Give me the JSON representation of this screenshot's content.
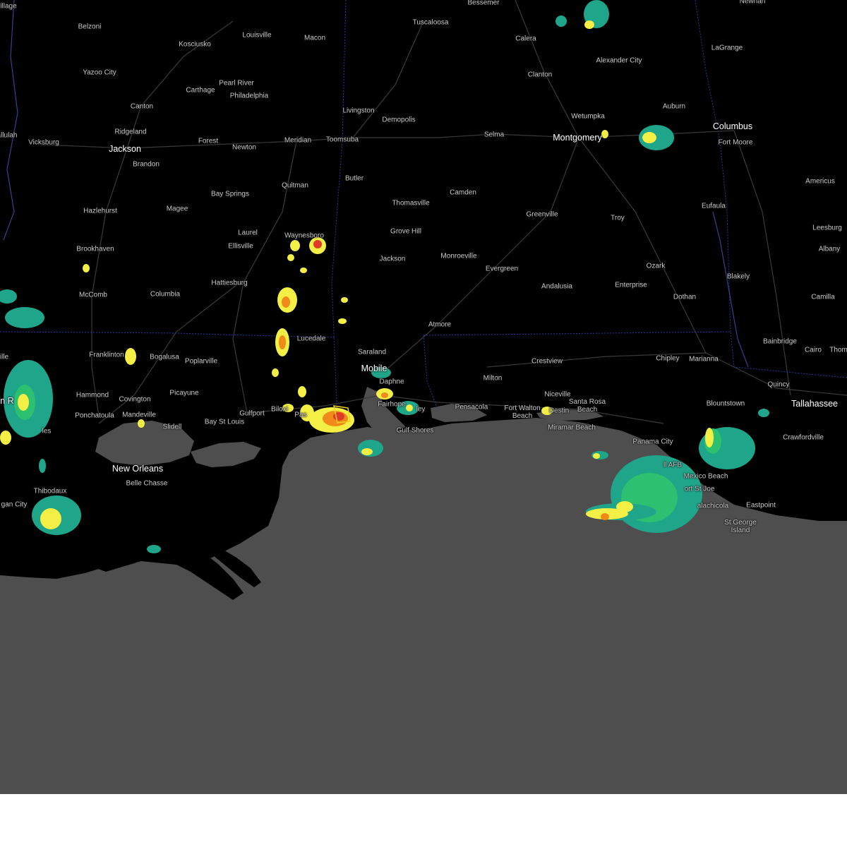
{
  "map": {
    "colors": {
      "land": "#000000",
      "water": "#4e4e4e",
      "roads": "#3a3a3a",
      "state_border": "#2a3aa0",
      "warning_box": "#f2d21a",
      "radar_light": "#1fa58a",
      "radar_mid": "#2cc070",
      "radar_yellow": "#f3ef45",
      "radar_orange": "#f08a1a",
      "radar_red": "#e23a2a"
    },
    "cities": [
      {
        "id": "bessemer",
        "name": "Bessemer"
      },
      {
        "id": "newnan",
        "name": "Newnan"
      },
      {
        "id": "tuscaloosa",
        "name": "Tuscaloosa"
      },
      {
        "id": "belzoni",
        "name": "Belzoni"
      },
      {
        "id": "louisville",
        "name": "Louisville"
      },
      {
        "id": "kosciusko",
        "name": "Kosciusko"
      },
      {
        "id": "macon",
        "name": "Macon"
      },
      {
        "id": "calera",
        "name": "Calera"
      },
      {
        "id": "lagrange",
        "name": "LaGrange"
      },
      {
        "id": "alexander-city",
        "name": "Alexander City"
      },
      {
        "id": "yazoo-city",
        "name": "Yazoo City"
      },
      {
        "id": "pearl-river",
        "name": "Pearl River"
      },
      {
        "id": "carthage",
        "name": "Carthage"
      },
      {
        "id": "clanton",
        "name": "Clanton"
      },
      {
        "id": "philadelphia",
        "name": "Philadelphia"
      },
      {
        "id": "canton",
        "name": "Canton"
      },
      {
        "id": "livingston",
        "name": "Livingston"
      },
      {
        "id": "auburn",
        "name": "Auburn"
      },
      {
        "id": "wetumpka",
        "name": "Wetumpka"
      },
      {
        "id": "demopolis",
        "name": "Demopolis"
      },
      {
        "id": "columbus",
        "name": "Columbus"
      },
      {
        "id": "ridgeland",
        "name": "Ridgeland"
      },
      {
        "id": "selma",
        "name": "Selma"
      },
      {
        "id": "montgomery",
        "name": "Montgomery"
      },
      {
        "id": "tallulah",
        "name": "allulah"
      },
      {
        "id": "meridian",
        "name": "Meridian"
      },
      {
        "id": "toomsuba",
        "name": "Toomsuba"
      },
      {
        "id": "forest",
        "name": "Forest"
      },
      {
        "id": "vicksburg",
        "name": "Vicksburg"
      },
      {
        "id": "fort-moore",
        "name": "Fort Moore"
      },
      {
        "id": "newton",
        "name": "Newton"
      },
      {
        "id": "jackson-ms",
        "name": "Jackson"
      },
      {
        "id": "brandon",
        "name": "Brandon"
      },
      {
        "id": "butler",
        "name": "Butler"
      },
      {
        "id": "americus",
        "name": "Americus"
      },
      {
        "id": "quitman",
        "name": "Quitman"
      },
      {
        "id": "camden",
        "name": "Camden"
      },
      {
        "id": "bay-springs",
        "name": "Bay Springs"
      },
      {
        "id": "thomasville",
        "name": "Thomasville"
      },
      {
        "id": "eufaula",
        "name": "Eufaula"
      },
      {
        "id": "hazlehurst",
        "name": "Hazlehurst"
      },
      {
        "id": "magee",
        "name": "Magee"
      },
      {
        "id": "greenville",
        "name": "Greenville"
      },
      {
        "id": "troy",
        "name": "Troy"
      },
      {
        "id": "leesburg",
        "name": "Leesburg"
      },
      {
        "id": "grove-hill",
        "name": "Grove Hill"
      },
      {
        "id": "laurel",
        "name": "Laurel"
      },
      {
        "id": "waynesboro",
        "name": "Waynesboro"
      },
      {
        "id": "ellisville",
        "name": "Ellisville"
      },
      {
        "id": "brookhaven",
        "name": "Brookhaven"
      },
      {
        "id": "albany",
        "name": "Albany"
      },
      {
        "id": "monroeville",
        "name": "Monroeville"
      },
      {
        "id": "jackson-al",
        "name": "Jackson"
      },
      {
        "id": "ozark",
        "name": "Ozark"
      },
      {
        "id": "evergreen",
        "name": "Evergreen"
      },
      {
        "id": "blakely",
        "name": "Blakely"
      },
      {
        "id": "hattiesburg",
        "name": "Hattiesburg"
      },
      {
        "id": "enterprise",
        "name": "Enterprise"
      },
      {
        "id": "andalusia",
        "name": "Andalusia"
      },
      {
        "id": "mccomb",
        "name": "McComb"
      },
      {
        "id": "columbia",
        "name": "Columbia"
      },
      {
        "id": "camilla",
        "name": "Camilla"
      },
      {
        "id": "dothan",
        "name": "Dothan"
      },
      {
        "id": "atmore",
        "name": "Atmore"
      },
      {
        "id": "lucedale",
        "name": "Lucedale"
      },
      {
        "id": "bainbridge",
        "name": "Bainbridge"
      },
      {
        "id": "saraland",
        "name": "Saraland"
      },
      {
        "id": "cairo",
        "name": "Cairo"
      },
      {
        "id": "thomasville-ga",
        "name": "Thom"
      },
      {
        "id": "franklinton",
        "name": "Franklinton"
      },
      {
        "id": "bogalusa",
        "name": "Bogalusa"
      },
      {
        "id": "chipley",
        "name": "Chipley"
      },
      {
        "id": "marianna",
        "name": "Marianna"
      },
      {
        "id": "crestview",
        "name": "Crestview"
      },
      {
        "id": "poplarville",
        "name": "Poplarville"
      },
      {
        "id": "mobile",
        "name": "Mobile"
      },
      {
        "id": "milton",
        "name": "Milton"
      },
      {
        "id": "daphne",
        "name": "Daphne"
      },
      {
        "id": "quincy",
        "name": "Quincy"
      },
      {
        "id": "picayune",
        "name": "Picayune"
      },
      {
        "id": "hammond",
        "name": "Hammond"
      },
      {
        "id": "niceville",
        "name": "Niceville"
      },
      {
        "id": "covington",
        "name": "Covington"
      },
      {
        "id": "baton-rouge",
        "name": "n R"
      },
      {
        "id": "blountstown",
        "name": "Blountstown"
      },
      {
        "id": "tallahassee",
        "name": "Tallahassee"
      },
      {
        "id": "fairhope",
        "name": "Fairhope"
      },
      {
        "id": "santa-rosa-beach",
        "name": "Santa Rosa Beach"
      },
      {
        "id": "pensacola",
        "name": "Pensacola"
      },
      {
        "id": "foley",
        "name": "ley"
      },
      {
        "id": "destin",
        "name": "Destin"
      },
      {
        "id": "fort-walton-beach",
        "name": "Fort Walton Beach"
      },
      {
        "id": "ponchatoula",
        "name": "Ponchatoula"
      },
      {
        "id": "mandeville",
        "name": "Mandeville"
      },
      {
        "id": "gulfport",
        "name": "Gulfport"
      },
      {
        "id": "biloxi",
        "name": "Biloxi"
      },
      {
        "id": "pascagoula",
        "name": "Pas"
      },
      {
        "id": "slidell",
        "name": "Slidell"
      },
      {
        "id": "bay-st-louis",
        "name": "Bay St Louis"
      },
      {
        "id": "gulf-shores",
        "name": "Gulf Shores"
      },
      {
        "id": "miramar-beach",
        "name": "Miramar Beach"
      },
      {
        "id": "crawfordville",
        "name": "Crawfordville"
      },
      {
        "id": "gonzales",
        "name": "les"
      },
      {
        "id": "panama-city",
        "name": "Panama City"
      },
      {
        "id": "new-orleans",
        "name": "New Orleans"
      },
      {
        "id": "tyndall-afb",
        "name": "ll AFB"
      },
      {
        "id": "mexico-beach",
        "name": "Mexico Beach"
      },
      {
        "id": "belle-chasse",
        "name": "Belle Chasse"
      },
      {
        "id": "port-st-joe",
        "name": "ort St Joe"
      },
      {
        "id": "thibodaux",
        "name": "Thibodaux"
      },
      {
        "id": "eastpoint",
        "name": "Eastpoint"
      },
      {
        "id": "apalachicola",
        "name": "alachicola"
      },
      {
        "id": "morgan-city",
        "name": "gan City"
      },
      {
        "id": "st-george-island",
        "name": "St George Island"
      },
      {
        "id": "ille-left",
        "name": "ille"
      },
      {
        "id": "illage",
        "name": "illage"
      }
    ]
  }
}
